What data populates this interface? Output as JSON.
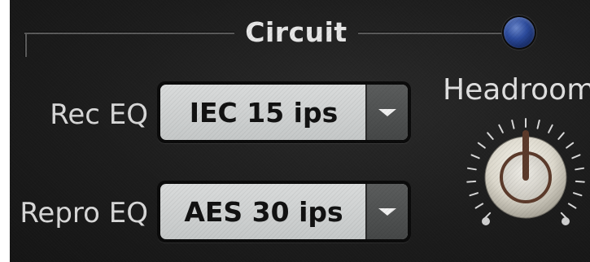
{
  "section": {
    "title": "Circuit"
  },
  "controls": {
    "rec_eq": {
      "label": "Rec EQ",
      "value": "IEC 15 ips"
    },
    "repro_eq": {
      "label": "Repro EQ",
      "value": "AES 30 ips"
    },
    "headroom": {
      "label": "Headroom"
    }
  },
  "colors": {
    "panel_bg": "#1c1c1c",
    "led_blue": "#2b4a9c",
    "dropdown_face": "#d0d2d2",
    "text_light": "#e0e0e0"
  },
  "icons": {
    "power_led": "led-indicator",
    "dropdown_arrow": "chevron-down-icon"
  }
}
